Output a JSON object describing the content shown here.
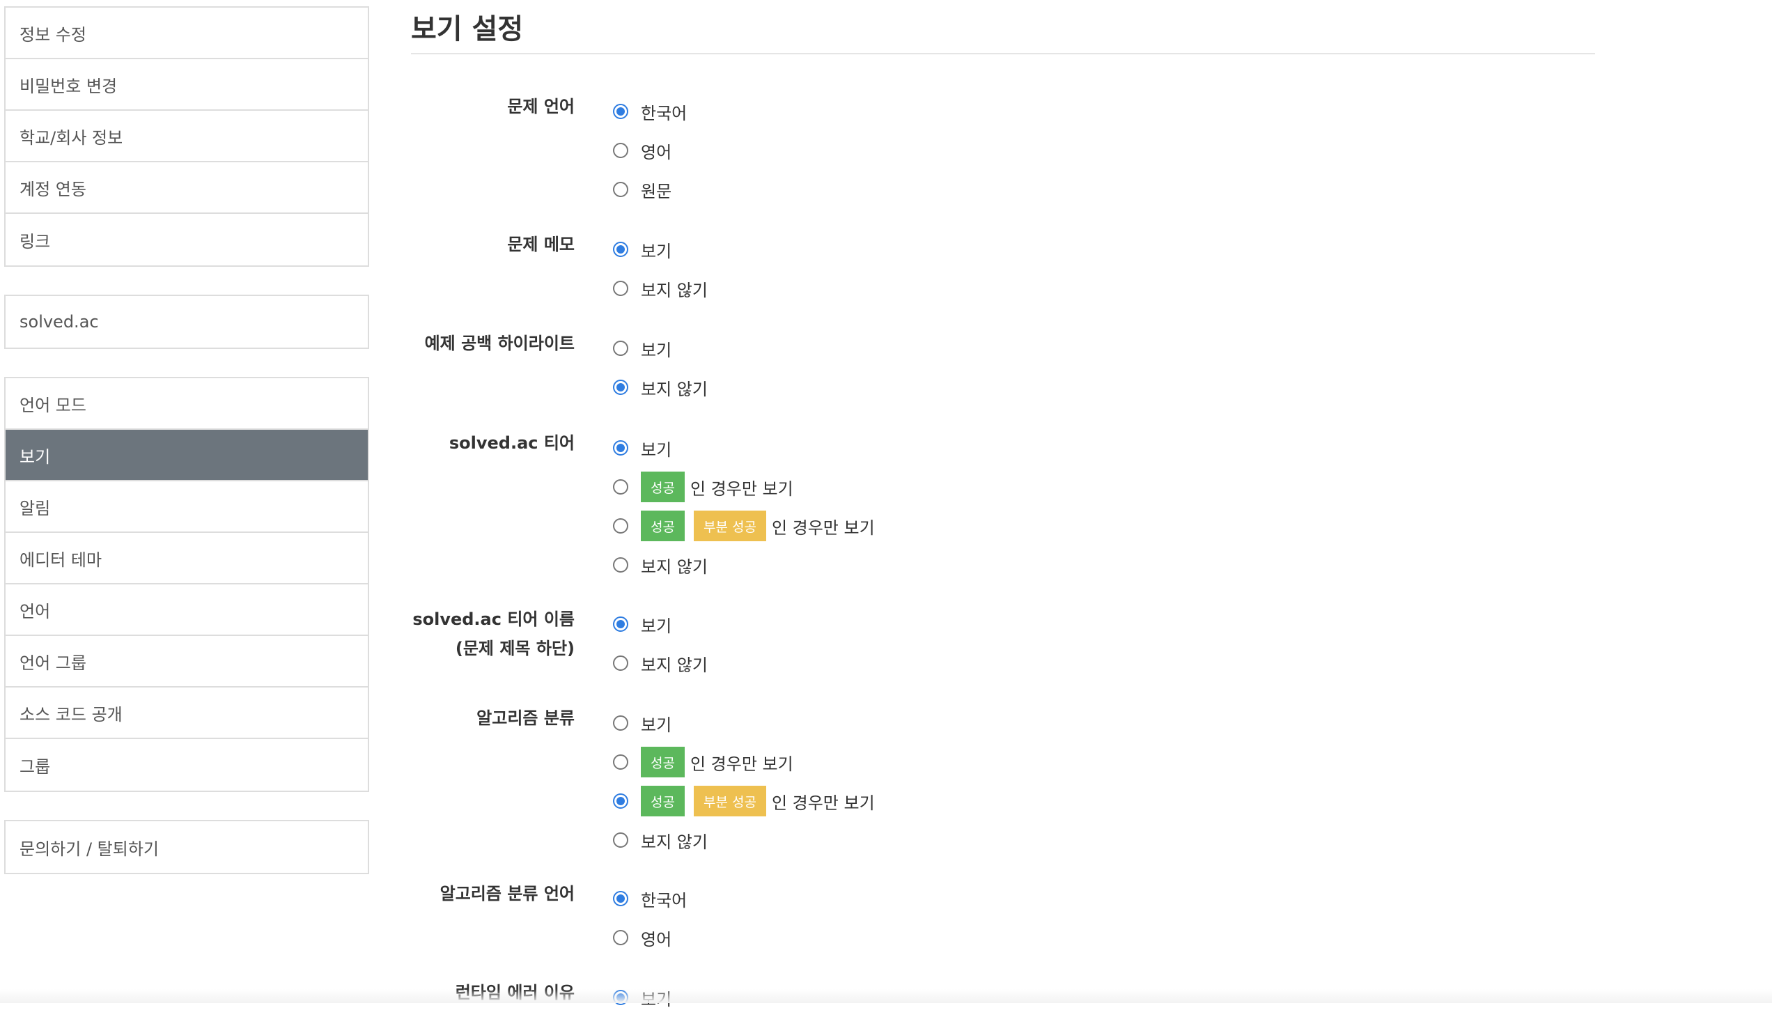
{
  "sidebar": {
    "group1": [
      "정보 수정",
      "비밀번호 변경",
      "학교/회사 정보",
      "계정 연동",
      "링크"
    ],
    "group2": [
      "solved.ac"
    ],
    "group3": [
      "언어 모드",
      "보기",
      "알림",
      "에디터 테마",
      "언어",
      "언어 그룹",
      "소스 코드 공개",
      "그룹"
    ],
    "group4": [
      "문의하기 / 탈퇴하기"
    ]
  },
  "page_title": "보기 설정",
  "badges": {
    "success": "성공",
    "partial": "부분 성공"
  },
  "settings": [
    {
      "label": "문제 언어",
      "options": [
        "한국어",
        "영어",
        "원문"
      ],
      "selected": 0
    },
    {
      "label": "문제 메모",
      "options": [
        "보기",
        "보지 않기"
      ],
      "selected": 0
    },
    {
      "label": "예제 공백 하이라이트",
      "options": [
        "보기",
        "보지 않기"
      ],
      "selected": 1
    },
    {
      "label": "solved.ac 티어",
      "options": [
        "보기",
        "인 경우만 보기",
        "인 경우만 보기",
        "보지 않기"
      ],
      "selected": 0
    },
    {
      "label": "solved.ac 티어 이름",
      "label2": "(문제 제목 하단)",
      "options": [
        "보기",
        "보지 않기"
      ],
      "selected": 0
    },
    {
      "label": "알고리즘 분류",
      "options": [
        "보기",
        "인 경우만 보기",
        "인 경우만 보기",
        "보지 않기"
      ],
      "selected": 2
    },
    {
      "label": "알고리즘 분류 언어",
      "options": [
        "한국어",
        "영어"
      ],
      "selected": 0
    },
    {
      "label": "런타임 에러 이유",
      "options": [
        "보기"
      ],
      "selected": 0
    }
  ]
}
